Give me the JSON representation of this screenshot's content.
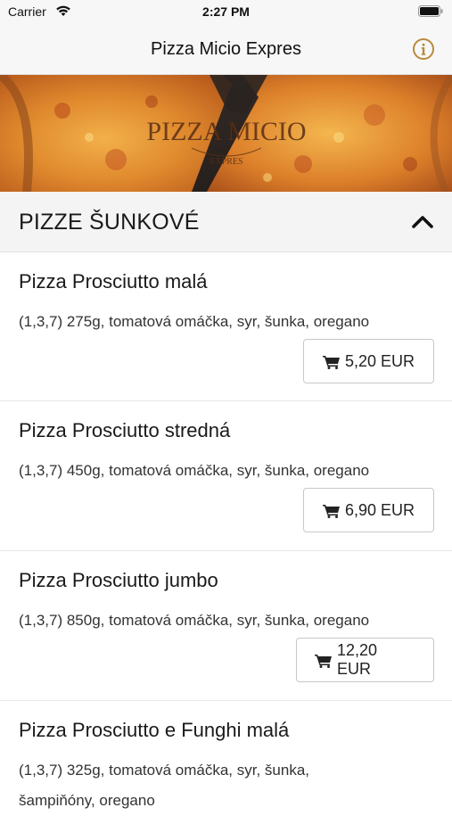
{
  "status_bar": {
    "carrier": "Carrier",
    "time": "2:27 PM"
  },
  "nav": {
    "title": "Pizza Micio Expres",
    "info_icon": "info-icon",
    "accent_color": "#b88a3c"
  },
  "banner": {
    "logo_text": "PIZZA MICIO",
    "logo_subtext": "EXPRES"
  },
  "category": {
    "title": "PIZZE ŠUNKOVÉ",
    "expanded": true
  },
  "items": [
    {
      "name": "Pizza Prosciutto malá",
      "description": "(1,3,7) 275g, tomatová omáčka, syr, šunka, oregano",
      "price": "5,20 EUR"
    },
    {
      "name": "Pizza Prosciutto stredná",
      "description": "(1,3,7) 450g, tomatová omáčka, syr, šunka, oregano",
      "price": "6,90 EUR"
    },
    {
      "name": "Pizza Prosciutto jumbo",
      "description": "(1,3,7) 850g, tomatová omáčka, syr, šunka, oregano",
      "price": "12,20 EUR"
    },
    {
      "name": "Pizza Prosciutto e Funghi malá",
      "description": "(1,3,7) 325g, tomatová omáčka, syr, šunka, šampiňóny, oregano"
    }
  ]
}
